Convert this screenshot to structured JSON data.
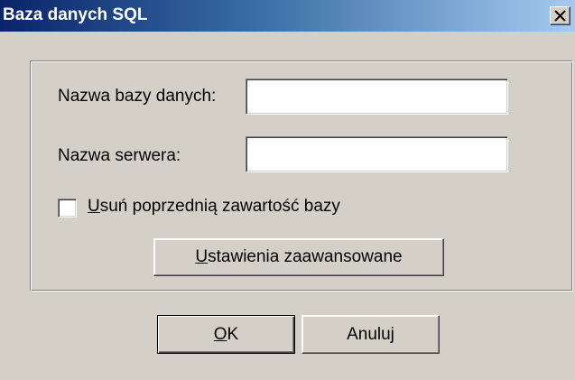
{
  "window": {
    "title": "Baza danych SQL",
    "close_icon": "close-icon"
  },
  "form": {
    "database_name": {
      "label": "Nazwa bazy danych:",
      "value": ""
    },
    "server_name": {
      "label": "Nazwa serwera:",
      "value": ""
    },
    "delete_previous": {
      "accel": "U",
      "label_rest": "suń poprzednią zawartość bazy",
      "checked": false
    },
    "advanced_button": {
      "accel": "U",
      "label_rest": "stawienia zaawansowane"
    }
  },
  "footer": {
    "ok": {
      "accel": "O",
      "label_rest": "K"
    },
    "cancel_label": "Anuluj"
  },
  "colors": {
    "titlebar_start": "#0a246a",
    "titlebar_end": "#a6caf0",
    "face": "#d4d0c8"
  }
}
